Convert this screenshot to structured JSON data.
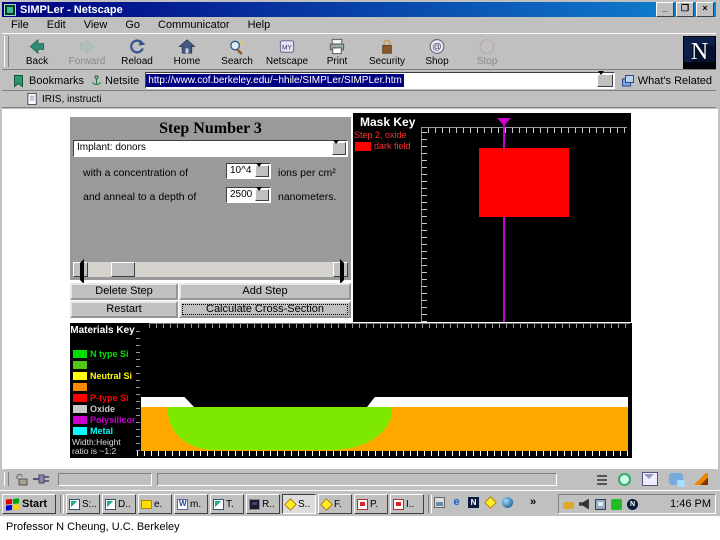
{
  "window": {
    "title": "SIMPLer - Netscape",
    "controls": {
      "minimize": "minimize",
      "restore": "restore",
      "close": "close"
    }
  },
  "menu": {
    "items": [
      {
        "label": "File"
      },
      {
        "label": "Edit"
      },
      {
        "label": "View"
      },
      {
        "label": "Go"
      },
      {
        "label": "Communicator"
      },
      {
        "label": "Help"
      }
    ]
  },
  "toolbar": {
    "buttons": [
      {
        "label": "Back",
        "icon": "back-arrow-icon",
        "enabled": true
      },
      {
        "label": "Forward",
        "icon": "forward-arrow-icon",
        "enabled": false
      },
      {
        "label": "Reload",
        "icon": "reload-icon",
        "enabled": true
      },
      {
        "label": "Home",
        "icon": "home-icon",
        "enabled": true
      },
      {
        "label": "Search",
        "icon": "search-icon",
        "enabled": true
      },
      {
        "label": "Netscape",
        "icon": "my-netscape-icon",
        "enabled": true
      },
      {
        "label": "Print",
        "icon": "print-icon",
        "enabled": true
      },
      {
        "label": "Security",
        "icon": "security-lock-icon",
        "enabled": true
      },
      {
        "label": "Shop",
        "icon": "shop-icon",
        "enabled": true
      },
      {
        "label": "Stop",
        "icon": "stop-icon",
        "enabled": false
      }
    ],
    "logo_letter": "N"
  },
  "location_bar": {
    "bookmarks_label": "Bookmarks",
    "netsite_label": "Netsite",
    "url": "http://www.cof.berkeley.edu/~hhile/SIMPLer/SIMPLer.htm",
    "whats_related_label": "What's Related"
  },
  "personal_bar": {
    "items": [
      {
        "label": "IRIS, instructi",
        "icon": "page-icon"
      }
    ]
  },
  "simulator": {
    "step_panel": {
      "title": "Step Number 3",
      "step_select_value": "Implant: donors",
      "concentration_label": "with a concentration of",
      "concentration_value": "10^4",
      "concentration_units": "ions per cm²",
      "depth_label": "and anneal to a depth of",
      "depth_value": "2500",
      "depth_units": "nanometers."
    },
    "buttons": {
      "delete_step": "Delete Step",
      "add_step": "Add Step",
      "restart": "Restart",
      "calculate": "Calculate Cross-Section"
    },
    "mask_key": {
      "title": "Mask Key",
      "step_label": "Step 2, oxide",
      "field_label": "dark field",
      "label_color": "#ff3333",
      "mask_color": "#ff0000",
      "cursor_color": "#cc00cc"
    },
    "materials_key": {
      "title": "Materials Key",
      "items": [
        {
          "label": "N type Si",
          "color": "#00e000"
        },
        {
          "label": "",
          "color": "#50c818"
        },
        {
          "label": "Neutral Si",
          "color": "#ffff00"
        },
        {
          "label": "",
          "color": "#ff8800"
        },
        {
          "label": "P-type Si",
          "color": "#ff0000"
        },
        {
          "label": "Oxide",
          "color": "#c8c8c8"
        },
        {
          "label": "Polysilicon",
          "color": "#cc00cc"
        },
        {
          "label": "Metal",
          "color": "#00ffff"
        }
      ],
      "note_line1": "Width:Height",
      "note_line2": "ratio is ~1:2"
    },
    "cross_section": {
      "substrate_color": "#ffa800",
      "implant_color": "#7de800",
      "oxide_color": "#ffffff"
    }
  },
  "status_bar": {
    "icons": [
      "padlock-open-icon",
      "plug-icon"
    ],
    "component_icons": [
      "menu-lines-icon",
      "navigator-icon",
      "mailbox-icon",
      "discussions-icon",
      "composer-icon"
    ]
  },
  "taskbar": {
    "start_label": "Start",
    "tasks": [
      {
        "label": "S:..",
        "icon": "netscape-doc-icon",
        "active": false
      },
      {
        "label": "D..",
        "icon": "netscape-doc-icon",
        "active": false
      },
      {
        "label": "e.",
        "icon": "folder-icon",
        "active": false
      },
      {
        "label": "m.",
        "icon": "word-doc-icon",
        "active": false
      },
      {
        "label": "T.",
        "icon": "netscape-doc-icon",
        "active": false
      },
      {
        "label": "R..",
        "icon": "terminal-icon",
        "active": false
      },
      {
        "label": "S..",
        "icon": "starburst-icon",
        "active": true
      },
      {
        "label": "F.",
        "icon": "starburst-icon",
        "active": false
      },
      {
        "label": "P.",
        "icon": "powerpoint-icon",
        "active": false
      },
      {
        "label": "I..",
        "icon": "powerpoint-icon",
        "active": false
      }
    ],
    "quick_launch_icons": [
      "show-desktop-icon",
      "internet-explorer-icon",
      "netscape-icon",
      "starburst-icon",
      "globe-icon"
    ],
    "overflow_chevron": "»",
    "tray_icons": [
      "key-icon",
      "volume-icon",
      "network-icon",
      "status-green-icon",
      "netscape-tray-icon"
    ],
    "clock": "1:46 PM"
  },
  "caption": "Professor  N Cheung, U.C. Berkeley"
}
